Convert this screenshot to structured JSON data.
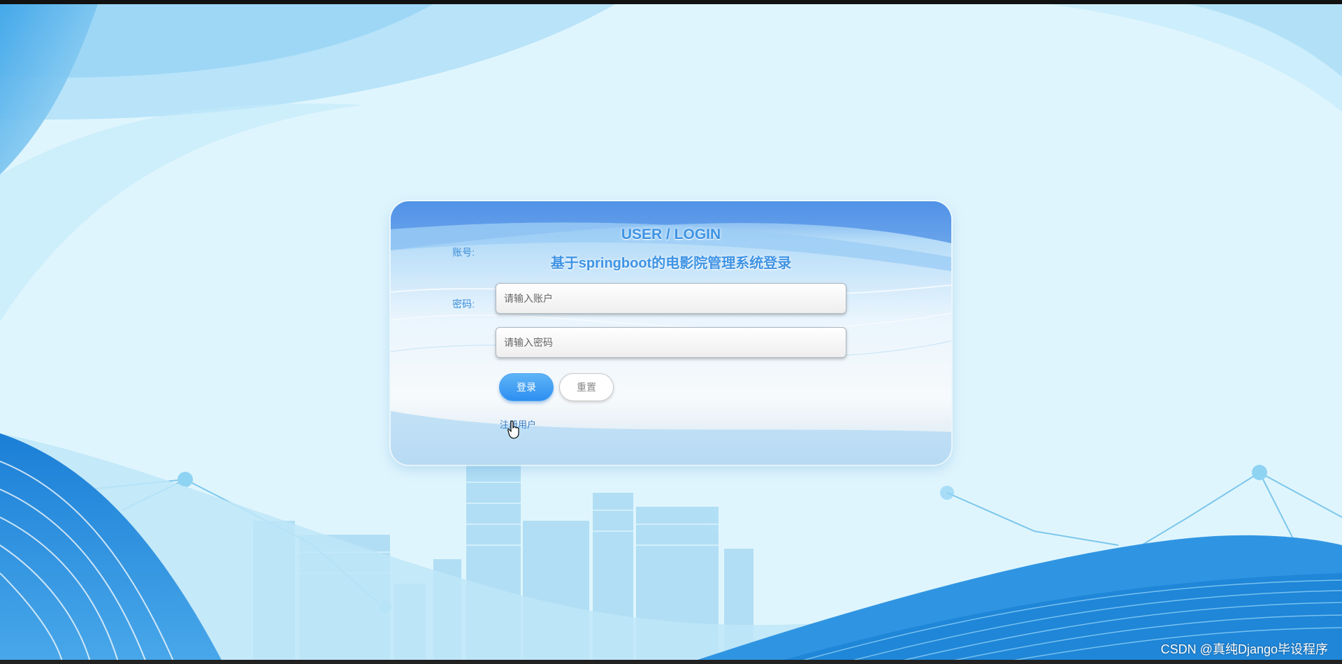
{
  "login": {
    "title_en": "USER / LOGIN",
    "title_cn": "基于springboot的电影院管理系统登录",
    "account_label": "账号:",
    "account_placeholder": "请输入账户",
    "password_label": "密码:",
    "password_placeholder": "请输入密码",
    "login_button": "登录",
    "reset_button": "重置",
    "register_link": "注册用户"
  },
  "watermark": "CSDN @真纯Django毕设程序",
  "icons": {
    "cursor": "hand-pointer-icon"
  },
  "colors": {
    "page_bg": "#dff5fd",
    "accent": "#3e93e4",
    "primary_button": "#3a99f3",
    "wave_dark": "#1f86d8"
  }
}
